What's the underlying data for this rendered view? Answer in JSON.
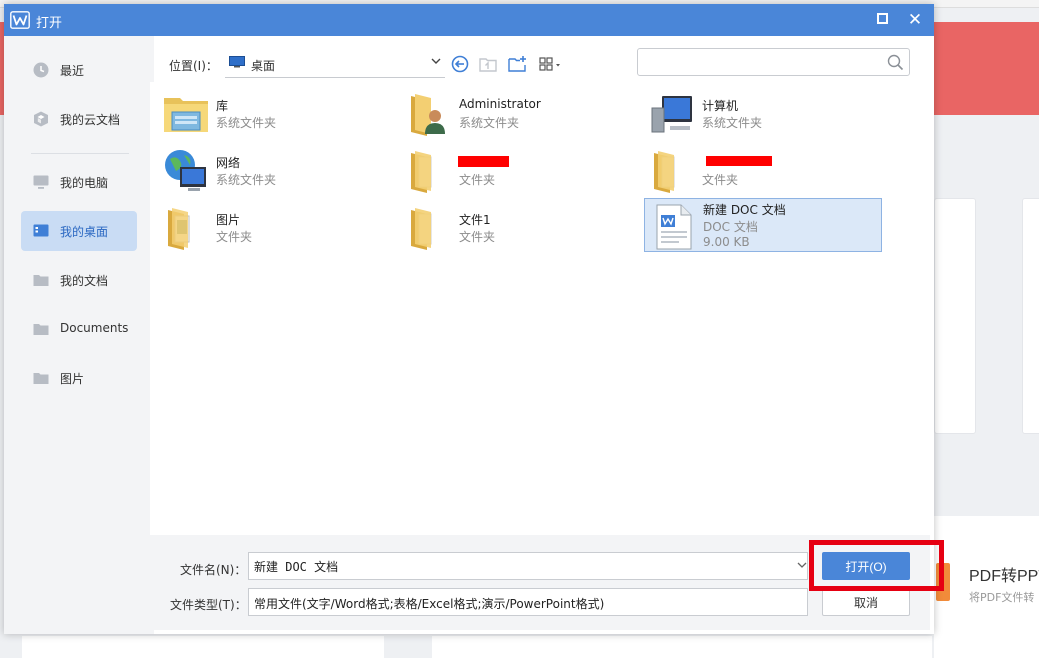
{
  "dialog": {
    "title": "打开",
    "title_icon": "wps-logo-icon",
    "maximize_icon": "maximize-icon",
    "close_icon": "close-icon"
  },
  "sidebar": {
    "items": [
      {
        "label": "最近",
        "icon": "clock-icon",
        "active": false
      },
      {
        "label": "我的云文档",
        "icon": "cloud-cube-icon",
        "active": false
      },
      {
        "label": "我的电脑",
        "icon": "monitor-icon",
        "active": false
      },
      {
        "label": "我的桌面",
        "icon": "desktop-icon",
        "active": true
      },
      {
        "label": "我的文档",
        "icon": "folder-icon",
        "active": false
      },
      {
        "label": "Documents",
        "icon": "folder-icon",
        "active": false
      },
      {
        "label": "图片",
        "icon": "folder-icon",
        "active": false
      }
    ]
  },
  "toolbar": {
    "location_label": "位置(I)：",
    "location_value": "桌面",
    "search_placeholder": ""
  },
  "files": [
    {
      "name": "库",
      "type": "系统文件夹",
      "size": "",
      "icon": "library-folder-icon"
    },
    {
      "name": "Administrator",
      "type": "系统文件夹",
      "size": "",
      "icon": "user-folder-icon"
    },
    {
      "name": "计算机",
      "type": "系统文件夹",
      "size": "",
      "icon": "computer-icon"
    },
    {
      "name": "网络",
      "type": "系统文件夹",
      "size": "",
      "icon": "network-globe-icon"
    },
    {
      "name": "",
      "type": "文件夹",
      "size": "",
      "icon": "folder-icon"
    },
    {
      "name": "",
      "type": "文件夹",
      "size": "",
      "icon": "folder-icon"
    },
    {
      "name": "图片",
      "type": "文件夹",
      "size": "",
      "icon": "folder-icon"
    },
    {
      "name": "文件1",
      "type": "文件夹",
      "size": "",
      "icon": "folder-icon"
    },
    {
      "name": "新建 DOC 文档",
      "type": "DOC 文档",
      "size": "9.00 KB",
      "icon": "wps-doc-icon",
      "selected": true
    }
  ],
  "bottom": {
    "filename_label": "文件名(N)：",
    "filename_value": "新建 DOC 文档",
    "filetype_label": "文件类型(T)：",
    "filetype_value": "常用文件(文字/Word格式;表格/Excel格式;演示/PowerPoint格式)",
    "open_label": "打开(O)",
    "cancel_label": "取消"
  },
  "background": {
    "pdf_title": "PDF转PPT",
    "pdf_subtitle": "将PDF文件转"
  },
  "colors": {
    "titlebar": "#4a86d8",
    "accent": "#4a86d8",
    "sidebar_active": "#c9dcf4",
    "highlight_frame": "#e60012",
    "background_band": "#e96564"
  }
}
